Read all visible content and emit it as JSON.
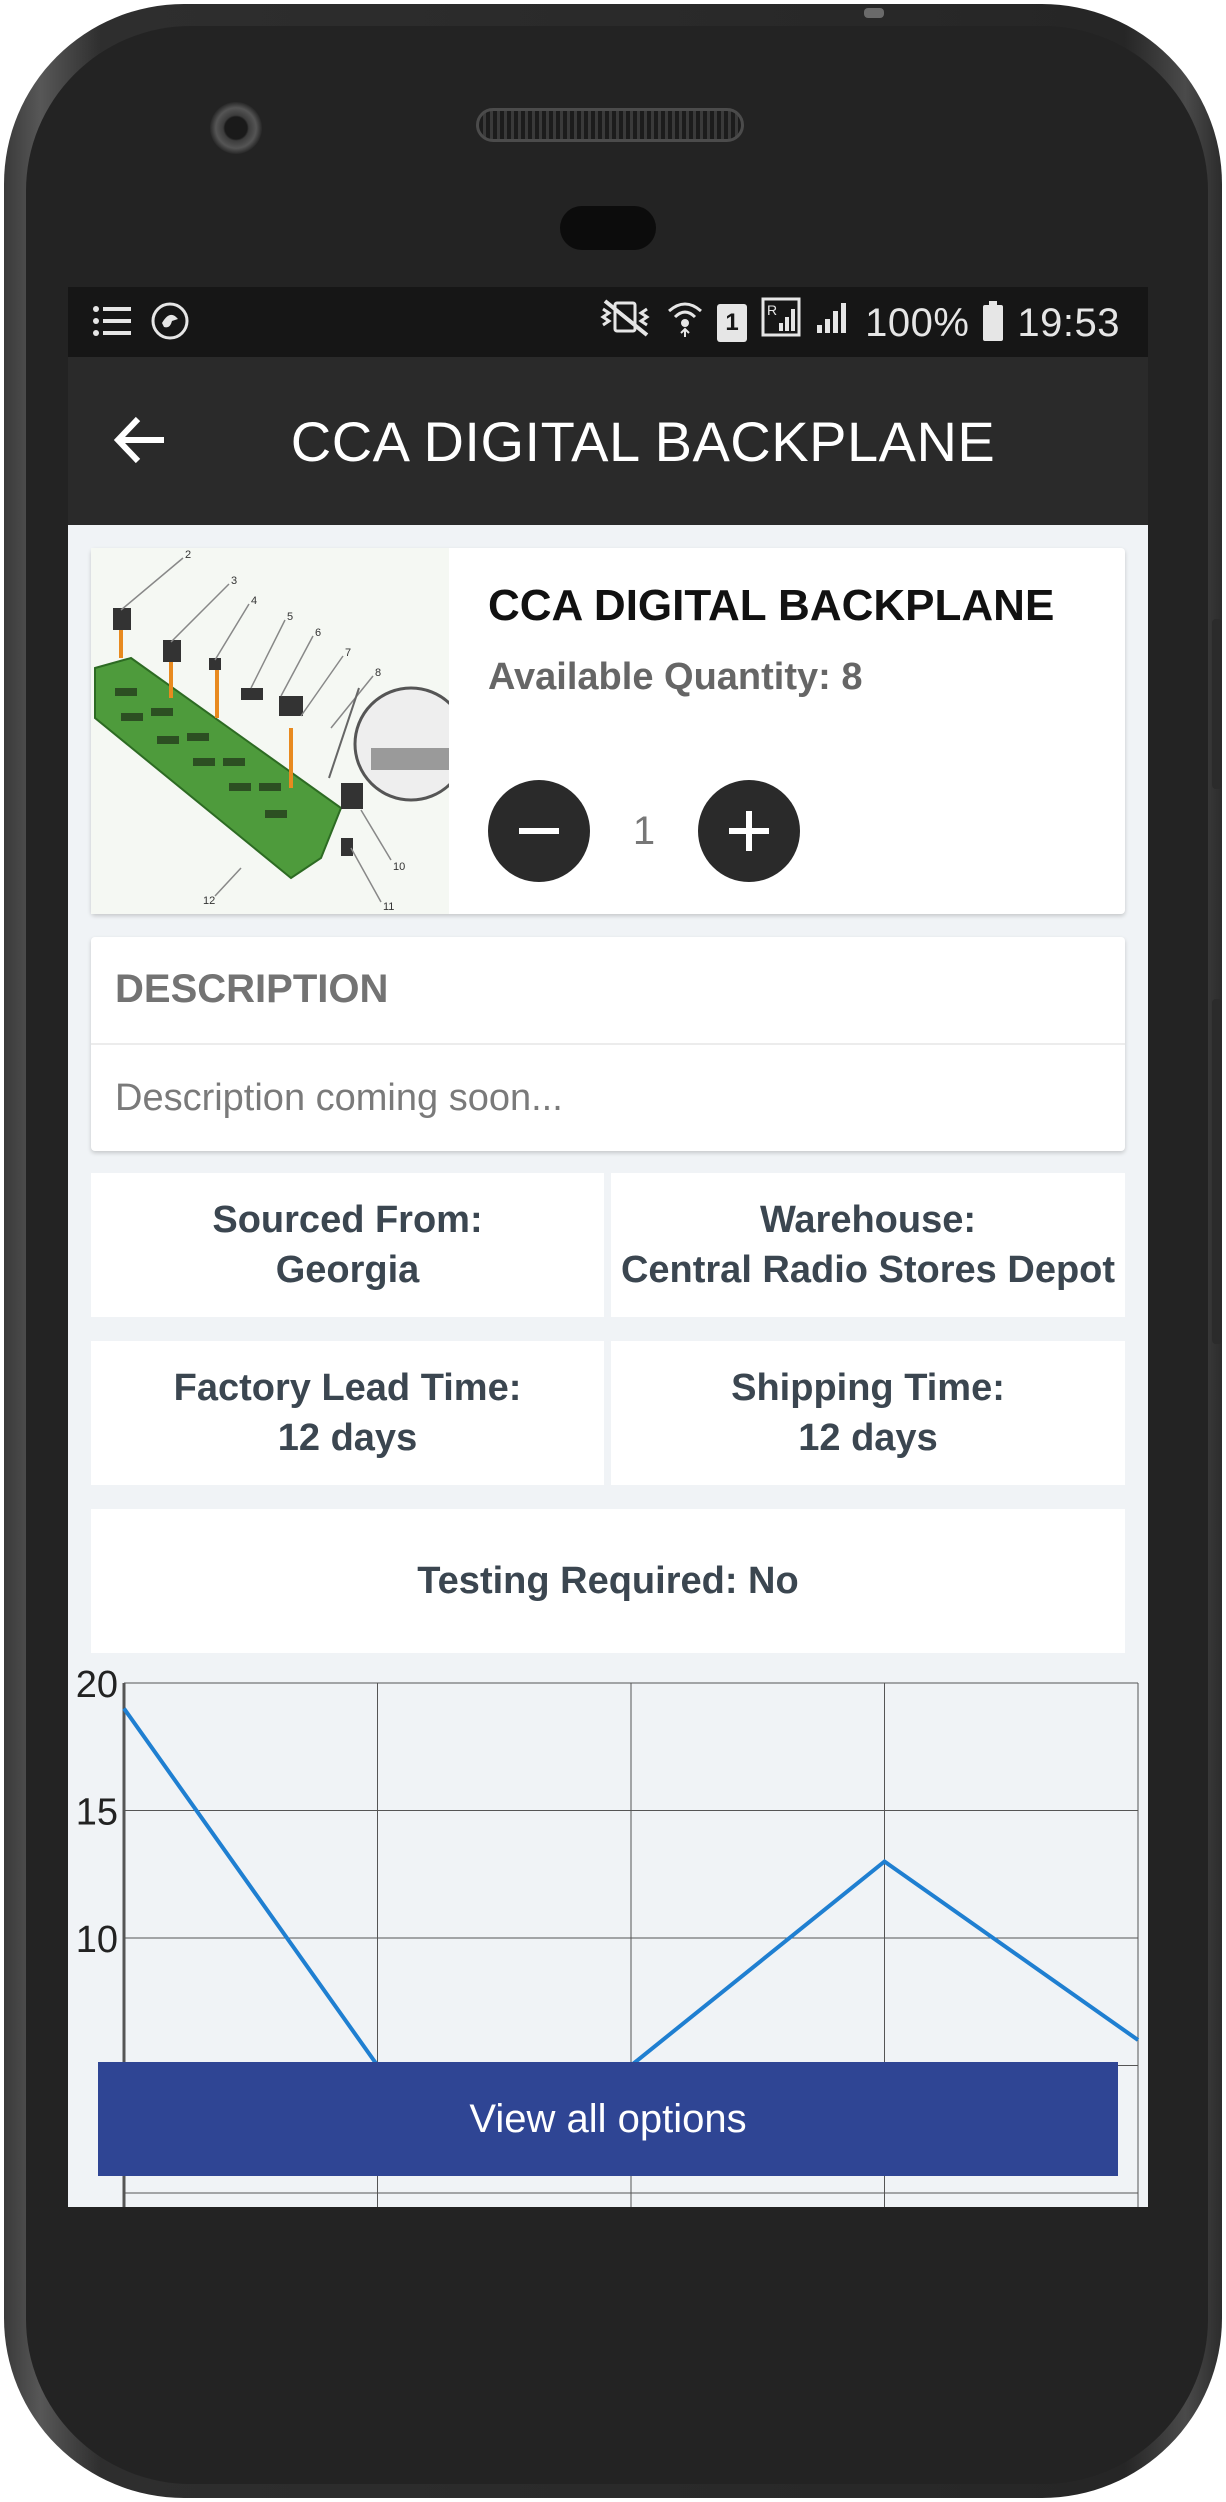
{
  "status_bar": {
    "left_icons": [
      "list-icon",
      "data-saver-icon"
    ],
    "battery_percent": "100%",
    "time": "19:53",
    "sim_label": "1"
  },
  "app_bar": {
    "title": "CCA DIGITAL BACKPLANE"
  },
  "product": {
    "name": "CCA DIGITAL BACKPLANE",
    "available_quantity": "Available Quantity: 8",
    "quantity": "1",
    "image_callouts": [
      "2",
      "3",
      "4",
      "5",
      "6",
      "7",
      "8",
      "10",
      "11",
      "12"
    ]
  },
  "description": {
    "title": "DESCRIPTION",
    "text": "Description coming soon..."
  },
  "details": {
    "sourced_label": "Sourced From:",
    "sourced_value": "Georgia",
    "warehouse_label": "Warehouse:",
    "warehouse_value": "Central Radio Stores Depot",
    "lead_label": "Factory Lead Time:",
    "lead_value": "12 days",
    "shipping_label": "Shipping Time:",
    "shipping_value": "12 days",
    "testing": "Testing Required: No"
  },
  "chart_data": {
    "type": "line",
    "x": [
      0,
      1,
      2,
      3,
      4
    ],
    "values": [
      19,
      5,
      5,
      13,
      6
    ],
    "ylim": [
      0,
      20
    ],
    "yticks": [
      20,
      15,
      10
    ],
    "grid": true,
    "color": "#1f7fd1"
  },
  "cta": {
    "label": "View all options"
  },
  "colors": {
    "app_bar": "#2a2a2a",
    "cta": "#2f4594",
    "screen_bg": "#f0f3f6"
  }
}
